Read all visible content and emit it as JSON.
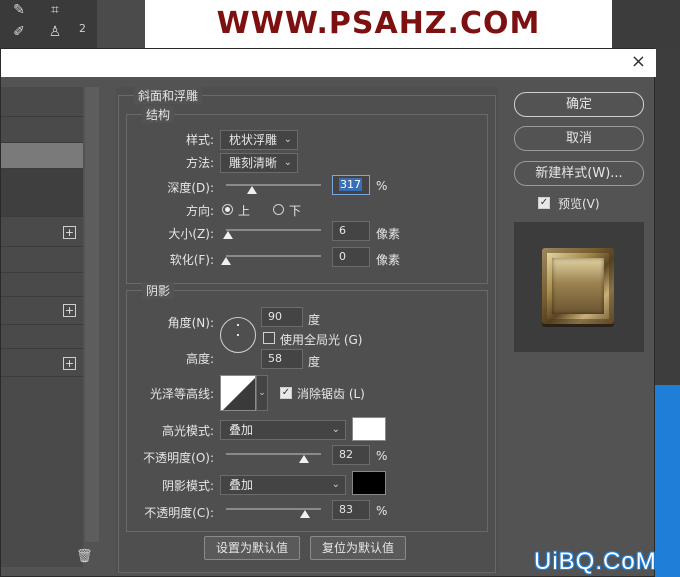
{
  "photoshop": {
    "watermark_top": "WWW.PSAHZ.COM",
    "ruler_digit": "2"
  },
  "dialog": {
    "close_glyph": "×"
  },
  "bevel": {
    "section_title": "斜面和浮雕",
    "structure": {
      "title": "结构",
      "style_label": "样式:",
      "style_value": "枕状浮雕",
      "technique_label": "方法:",
      "technique_value": "雕刻清晰",
      "depth_label": "深度(D):",
      "depth_value": "317",
      "depth_unit": "%",
      "depth_level": 0.27,
      "direction_label": "方向:",
      "direction_up": "上",
      "direction_down": "下",
      "direction_selected": "up",
      "size_label": "大小(Z):",
      "size_value": "6",
      "size_unit": "像素",
      "size_level": 0.02,
      "soften_label": "软化(F):",
      "soften_value": "0",
      "soften_unit": "像素",
      "soften_level": 0.0
    },
    "shading": {
      "title": "阴影",
      "angle_label": "角度(N):",
      "angle_value": "90",
      "angle_unit": "度",
      "global_light_label": "使用全局光 (G)",
      "global_light_checked": false,
      "altitude_label": "高度:",
      "altitude_value": "58",
      "altitude_unit": "度",
      "gloss_contour_label": "光泽等高线:",
      "anti_alias_label": "消除锯齿 (L)",
      "anti_alias_checked": true,
      "highlight_mode_label": "高光模式:",
      "highlight_mode_value": "叠加",
      "highlight_color": "#ffffff",
      "highlight_opacity_label": "不透明度(O):",
      "highlight_opacity_value": "82",
      "highlight_opacity_unit": "%",
      "highlight_opacity_level": 0.82,
      "shadow_mode_label": "阴影模式:",
      "shadow_mode_value": "叠加",
      "shadow_color": "#000000",
      "shadow_opacity_label": "不透明度(C):",
      "shadow_opacity_value": "83",
      "shadow_opacity_unit": "%",
      "shadow_opacity_level": 0.83
    },
    "make_default_label": "设置为默认值",
    "reset_default_label": "复位为默认值"
  },
  "right": {
    "ok_label": "确定",
    "cancel_label": "取消",
    "new_style_label": "新建样式(W)...",
    "preview_label": "预览(V)",
    "preview_checked": true
  },
  "watermark_bottom": "UiBQ.CoM"
}
